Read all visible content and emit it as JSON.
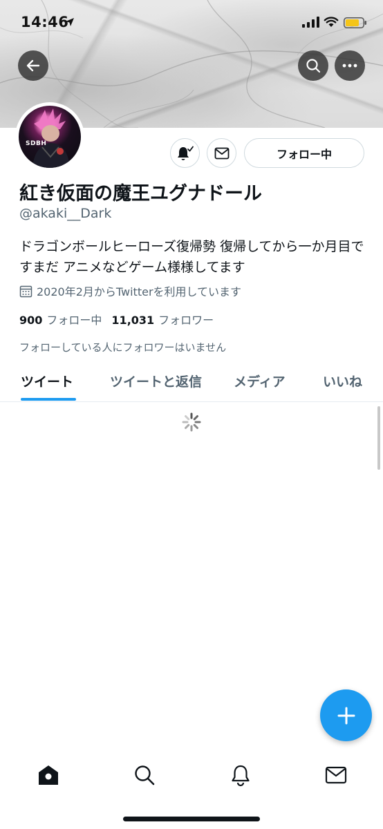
{
  "status_bar": {
    "time": "14:46",
    "icons": [
      "location-arrow-icon",
      "signal-icon",
      "wifi-icon",
      "battery-icon"
    ],
    "battery_color": "#f5c518"
  },
  "header": {
    "back_icon": "arrow-left-icon",
    "search_icon": "search-icon",
    "more_icon": "more-dots-icon"
  },
  "profile": {
    "avatar_text": "SDBH",
    "display_name": "紅き仮面の魔王ユグナドール",
    "handle": "@akaki__Dark",
    "bio": "ドラゴンボールヒーローズ復帰勢 復帰してから一か月目ですまだ アニメなどゲーム様様してます",
    "joined": "2020年2月からTwitterを利用しています",
    "following_count": "900",
    "following_label": "フォロー中",
    "followers_count": "11,031",
    "followers_label": "フォロワー",
    "followers_you_know": "フォローしている人にフォロワーはいません"
  },
  "actions": {
    "notify_icon": "bell-check-icon",
    "message_icon": "mail-icon",
    "follow_label": "フォロー中"
  },
  "tabs": [
    {
      "label": "ツイート",
      "active": true
    },
    {
      "label": "ツイートと返信",
      "active": false
    },
    {
      "label": "メディア",
      "active": false
    },
    {
      "label": "いいね",
      "active": false
    }
  ],
  "fab": {
    "icon": "plus-icon"
  },
  "bottom_nav": [
    {
      "icon": "home-icon"
    },
    {
      "icon": "search-icon"
    },
    {
      "icon": "bell-icon"
    },
    {
      "icon": "mail-icon"
    }
  ],
  "colors": {
    "accent": "#1d9bf0",
    "text_primary": "#0f1419",
    "text_secondary": "#536471",
    "border": "#cfd9de"
  }
}
